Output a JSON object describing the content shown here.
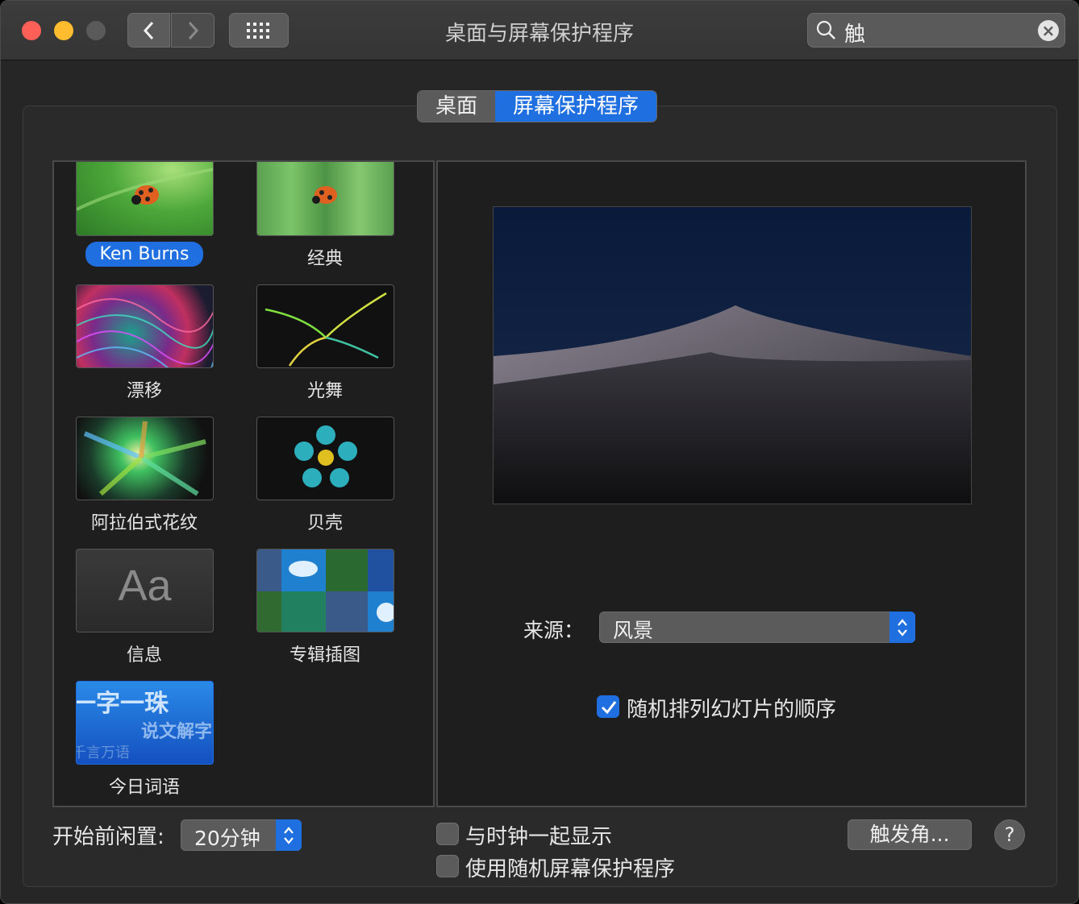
{
  "window": {
    "title": "桌面与屏幕保护程序"
  },
  "toolbar": {
    "back_icon": "chevron-left-icon",
    "forward_icon": "chevron-right-icon",
    "grid_icon": "grid-icon"
  },
  "search": {
    "value": "触",
    "icon": "search-icon",
    "clear_icon": "clear-icon"
  },
  "tabs": [
    {
      "label": "桌面",
      "active": false
    },
    {
      "label": "屏幕保护程序",
      "active": true
    }
  ],
  "screensavers": [
    {
      "label": "Ken Burns",
      "selected": true
    },
    {
      "label": "经典",
      "selected": false
    },
    {
      "label": "漂移",
      "selected": false
    },
    {
      "label": "光舞",
      "selected": false
    },
    {
      "label": "阿拉伯式花纹",
      "selected": false
    },
    {
      "label": "贝壳",
      "selected": false
    },
    {
      "label": "信息",
      "selected": false,
      "thumb_text": "Aa"
    },
    {
      "label": "专辑插图",
      "selected": false
    },
    {
      "label": "今日词语",
      "selected": false,
      "thumb_lines": [
        "一字一珠",
        "说文解字",
        "千言万语"
      ]
    }
  ],
  "options": {
    "source_label": "来源：",
    "source_value": "风景",
    "shuffle_label": "随机排列幻灯片的顺序",
    "shuffle_checked": true
  },
  "bottom": {
    "idle_label": "开始前闲置:",
    "idle_value": "20分钟",
    "show_clock_label": "与时钟一起显示",
    "show_clock_checked": false,
    "random_label": "使用随机屏幕保护程序",
    "random_checked": false,
    "hot_corners_label": "触发角...",
    "help_label": "?"
  },
  "colors": {
    "accent": "#1f6fe0",
    "background": "#262626"
  }
}
